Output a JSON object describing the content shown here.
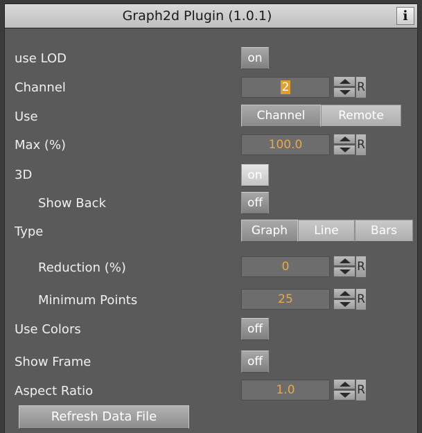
{
  "title": "Graph2d Plugin (1.0.1)",
  "info_glyph": "i",
  "reset_glyph": "R",
  "rows": {
    "use_lod": {
      "label": "use LOD",
      "toggle": "on"
    },
    "channel": {
      "label": "Channel",
      "value": "2"
    },
    "use": {
      "label": "Use",
      "options": [
        "Channel",
        "Remote"
      ],
      "selected": "Channel"
    },
    "max": {
      "label": "Max (%)",
      "value": "100.0"
    },
    "three_d": {
      "label": "3D",
      "toggle": "on"
    },
    "show_back": {
      "label": "Show Back",
      "toggle": "off"
    },
    "type": {
      "label": "Type",
      "options": [
        "Graph",
        "Line",
        "Bars"
      ],
      "selected": "Graph"
    },
    "reduction": {
      "label": "Reduction (%)",
      "value": "0"
    },
    "min_points": {
      "label": "Minimum Points",
      "value": "25"
    },
    "use_colors": {
      "label": "Use Colors",
      "toggle": "off"
    },
    "show_frame": {
      "label": "Show Frame",
      "toggle": "off"
    },
    "aspect_ratio": {
      "label": "Aspect Ratio",
      "value": "1.0"
    }
  },
  "refresh_button": "Refresh Data File",
  "colors": {
    "value_text": "#e8a94a",
    "selection": "#e59d2a",
    "panel": "#5a5a5a"
  }
}
